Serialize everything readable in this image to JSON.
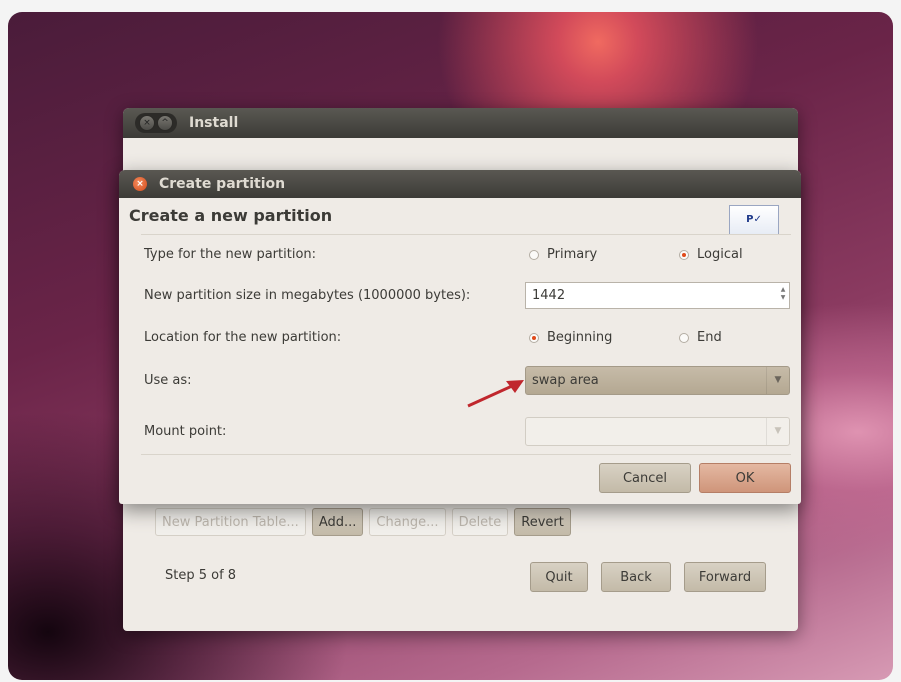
{
  "install_window": {
    "title": "Install",
    "toolbar": {
      "new_partition_table": "New Partition Table...",
      "add": "Add...",
      "change": "Change...",
      "delete": "Delete",
      "revert": "Revert"
    },
    "step": "Step 5 of 8",
    "nav": {
      "quit": "Quit",
      "back": "Back",
      "forward": "Forward"
    }
  },
  "dialog": {
    "title": "Create partition",
    "heading": "Create a new partition",
    "type_label": "Type for the new partition:",
    "type_options": {
      "primary": "Primary",
      "logical": "Logical",
      "selected": "Logical"
    },
    "size_label": "New partition size in megabytes (1000000 bytes):",
    "size_value": "1442",
    "location_label": "Location for the new partition:",
    "location_options": {
      "beginning": "Beginning",
      "end": "End",
      "selected": "Beginning"
    },
    "use_as_label": "Use as:",
    "use_as_value": "swap area",
    "mount_label": "Mount point:",
    "mount_value": "",
    "buttons": {
      "cancel": "Cancel",
      "ok": "OK"
    }
  },
  "colors": {
    "accent": "#e04a1a",
    "arrow": "#c0272d"
  }
}
